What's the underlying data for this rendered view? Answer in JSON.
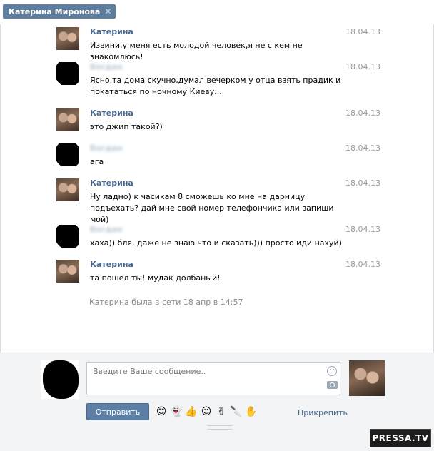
{
  "tab": {
    "title": "Катерина Миронова",
    "close_icon": "close-icon"
  },
  "messages": [
    {
      "author": "Катерина",
      "date": "18.04.13",
      "text": "Извини,у меня есть молодой человек,я не с кем не знакомлюсь!",
      "avatar": "katya"
    },
    {
      "author": "Богдан",
      "date": "18.04.13",
      "text": "Ясно,та дома скучно,думал вечерком у отца взять прадик и покататься по ночному Киеву...",
      "avatar": "anon"
    },
    {
      "author": "Катерина",
      "date": "18.04.13",
      "text": "это джип такой?)",
      "avatar": "katya"
    },
    {
      "author": "Богдан",
      "date": "18.04.13",
      "text": "ага",
      "avatar": "anon"
    },
    {
      "author": "Катерина",
      "date": "18.04.13",
      "text": "Ну ладно) к часикам 8 сможешь ко мне на дарницу подъехать? дай мне свой номер телефончика или запиши мой)",
      "avatar": "katya"
    },
    {
      "author": "Богдан",
      "date": "18.04.13",
      "text": "хаха)) бля, даже не знаю что и сказать))) просто иди нахуй)",
      "avatar": "anon"
    },
    {
      "author": "Катерина",
      "date": "18.04.13",
      "text": "та пошел ты! мудак долбаный!",
      "avatar": "katya"
    }
  ],
  "status_line": "Катерина была в сети 18 апр в 14:57",
  "composer": {
    "placeholder": "Введите Ваше сообщение..",
    "send_label": "Отправить",
    "attach_label": "Прикрепить",
    "emojis": [
      "😊",
      "👻",
      "👍",
      "😉",
      "✌",
      "🔪",
      "✋"
    ]
  },
  "watermark": "PRESSA.TV"
}
